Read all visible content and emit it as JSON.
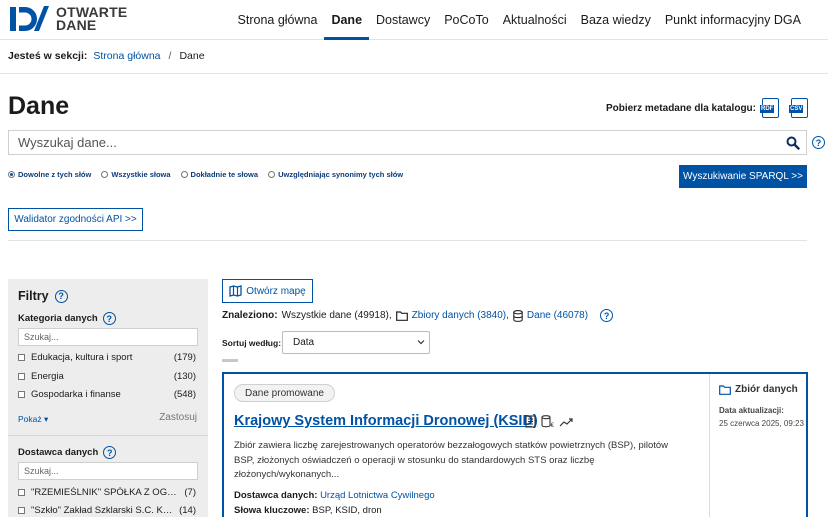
{
  "brand": {
    "line1": "OTWARTE",
    "line2": "DANE",
    "accent_color": "#0052a5"
  },
  "nav": {
    "items": [
      {
        "label": "Strona główna"
      },
      {
        "label": "Dane"
      },
      {
        "label": "Dostawcy"
      },
      {
        "label": "PoCoTo"
      },
      {
        "label": "Aktualności"
      },
      {
        "label": "Baza wiedzy"
      },
      {
        "label": "Punkt informacyjny DGA"
      }
    ],
    "active_index": 1
  },
  "breadcrumb": {
    "label": "Jesteś w sekcji:",
    "home": "Strona główna",
    "separator": "/",
    "current": "Dane"
  },
  "page": {
    "title": "Dane"
  },
  "metadata_download": {
    "label": "Pobierz metadane dla katalogu:",
    "rdf": "RDF",
    "csv": "CSV"
  },
  "search": {
    "placeholder": "Wyszukaj dane...",
    "help": "?",
    "modes": [
      {
        "label": "Dowolne z tych słów",
        "selected": true
      },
      {
        "label": "Wszystkie słowa",
        "selected": false
      },
      {
        "label": "Dokładnie te słowa",
        "selected": false
      },
      {
        "label": "Uwzględniając synonimy tych słów",
        "selected": false
      }
    ],
    "sparql_button": "Wyszukiwanie SPARQL >>",
    "api_validator_button": "Walidator zgodności API >>"
  },
  "filters": {
    "title": "Filtry",
    "category": {
      "label": "Kategoria danych",
      "search_placeholder": "Szukaj...",
      "items": [
        {
          "name": "Edukacja, kultura i sport",
          "count": "(179)"
        },
        {
          "name": "Energia",
          "count": "(130)"
        },
        {
          "name": "Gospodarka i finanse",
          "count": "(548)"
        }
      ],
      "more": "Pokaż ▾",
      "apply": "Zastosuj"
    },
    "provider": {
      "label": "Dostawca danych",
      "search_placeholder": "Szukaj...",
      "items": [
        {
          "name": "\"RZEMIEŚLNIK\" SPÓŁKA Z OGRANICZONĄ ODPOWIEDZIALNOŚCIĄ",
          "count": "(7)"
        },
        {
          "name": "\"Szkło\" Zakład Szklarski S.C. Krystyna",
          "count": "(14)"
        }
      ]
    }
  },
  "results": {
    "map_button": "Otwórz mapę",
    "found_label": "Znaleziono:",
    "all": "Wszystkie dane (49918),",
    "datasets": "Zbiory danych (3840),",
    "resources": "Dane (46078)",
    "sort_label": "Sortuj według:",
    "sort_value": "Data"
  },
  "card": {
    "badge": "Dane promowane",
    "title": "Krajowy System Informacji Dronowej (KSID)",
    "description": "Zbiór zawiera liczbę zarejestrowanych operatorów bezzałogowych statków powietrznych (BSP), pilotów BSP, złożonych oświadczeń o operacji w stosunku do standardowych STS oraz liczbę złożonych/wykonanych...",
    "provider_label": "Dostawca danych:",
    "provider": "Urząd Lotnictwa Cywilnego",
    "keywords_label": "Słowa kluczowe:",
    "keywords": "BSP, KSID, dron",
    "type": "Zbiór danych",
    "updated_label": "Data aktualizacji:",
    "updated_value": "25 czerwca 2025, 09:23"
  }
}
